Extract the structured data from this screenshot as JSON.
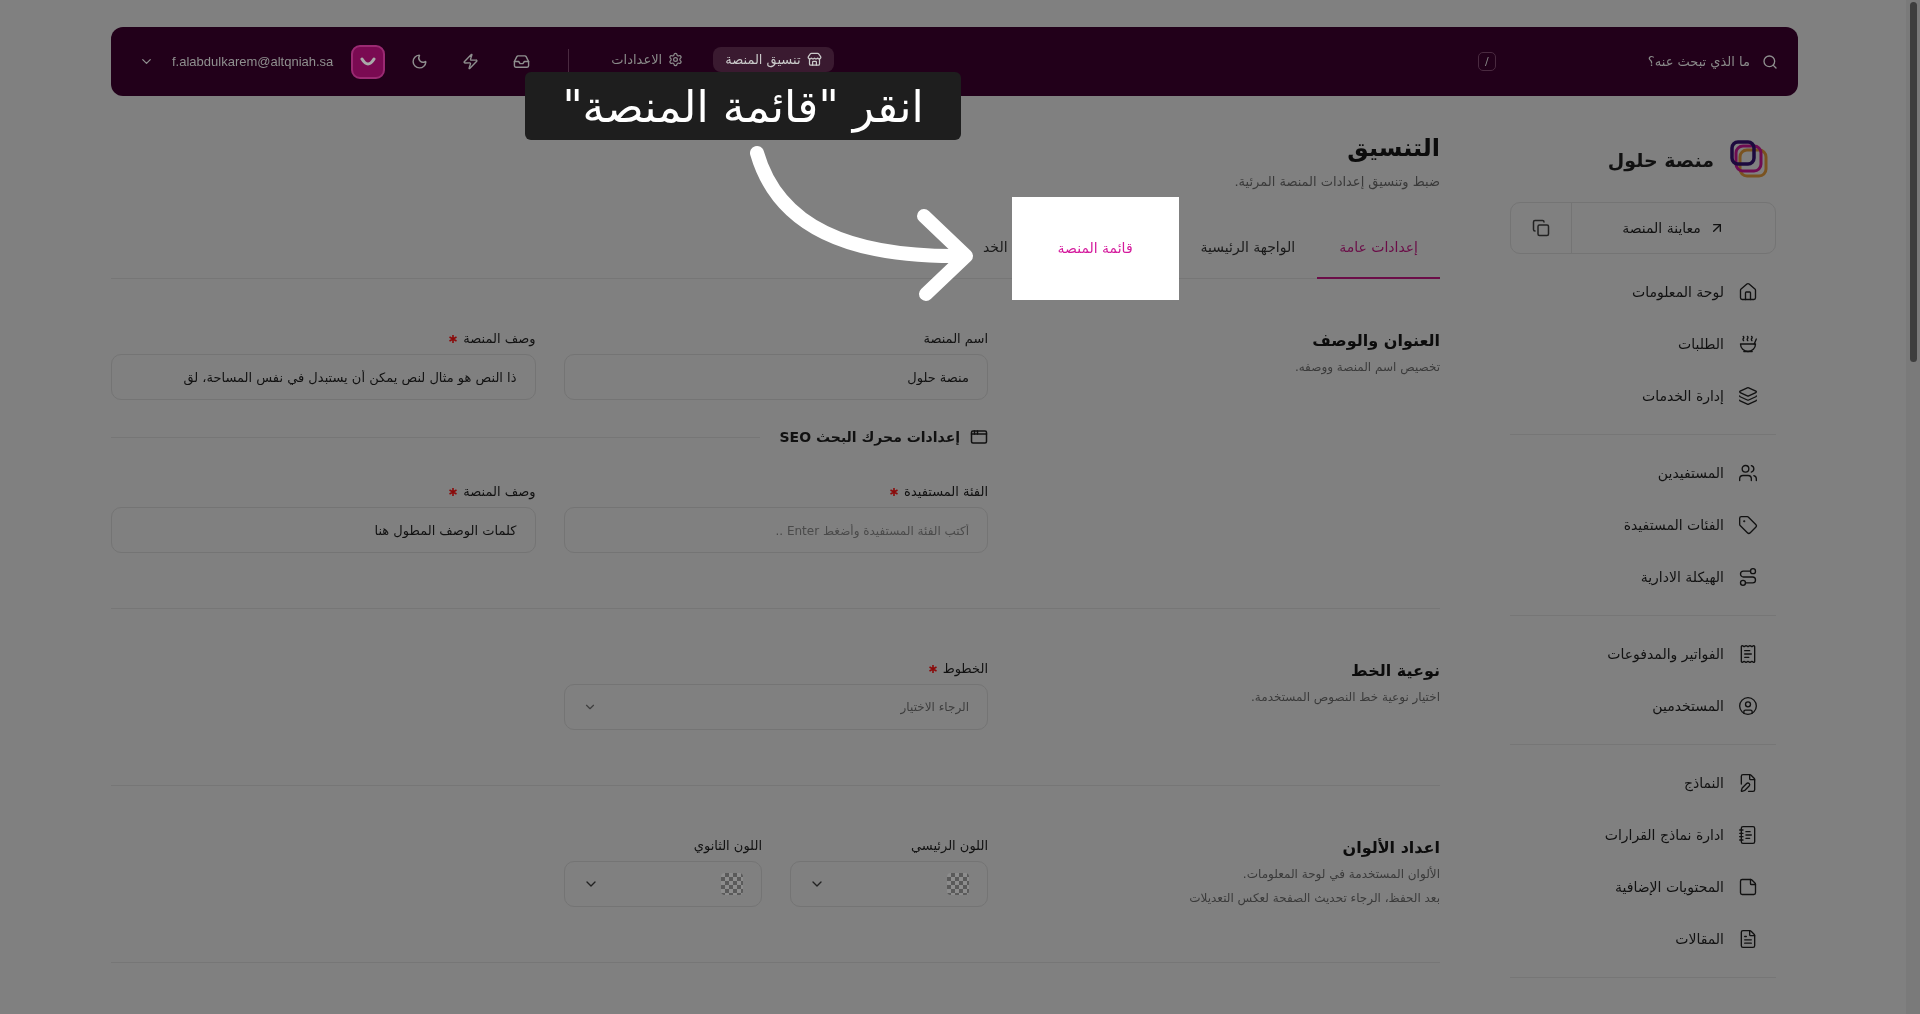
{
  "topbar": {
    "search_placeholder": "ما الذي تبحث عنه؟",
    "shortcut": "/",
    "nav": [
      {
        "label": "تنسيق المنصة",
        "selected": true
      },
      {
        "label": "الاعدادات",
        "selected": false
      }
    ],
    "user_email": "f.alabdulkarem@altqniah.sa"
  },
  "sidebar": {
    "brand": "منصة حلول",
    "preview_button": "معاينة المنصة",
    "groups": [
      [
        {
          "label": "لوحة المعلومات"
        },
        {
          "label": "الطلبات"
        },
        {
          "label": "إدارة الخدمات"
        }
      ],
      [
        {
          "label": "المستفيدين"
        },
        {
          "label": "الفئات المستفيدة"
        },
        {
          "label": "الهيكلة الادارية"
        }
      ],
      [
        {
          "label": "الفواتير والمدفوعات"
        },
        {
          "label": "المستخدمين"
        }
      ],
      [
        {
          "label": "النماذج"
        },
        {
          "label": "ادارة نماذج القرارات"
        },
        {
          "label": "المحتويات الإضافية"
        },
        {
          "label": "المقالات"
        }
      ]
    ]
  },
  "page": {
    "title": "التنسيق",
    "subtitle": "ضبط وتنسيق إعدادات المنصة المرئية."
  },
  "tabs": [
    {
      "label": "إعدادات عامة",
      "selected": true,
      "spotlight": false
    },
    {
      "label": "الواجهة الرئيسية",
      "selected": false,
      "spotlight": false
    },
    {
      "label": "قائمة المنصة",
      "selected": false,
      "spotlight": true
    },
    {
      "label": "الخد",
      "selected": false,
      "spotlight": false
    }
  ],
  "sections": [
    {
      "title": "العنوان والوصف",
      "descriptions": [
        "تخصيص اسم المنصة ووصفه."
      ],
      "rows": [
        {
          "kind": "fields",
          "fields": [
            {
              "kind": "text",
              "label": "اسم المنصة",
              "required": false,
              "value": "منصة حلول"
            },
            {
              "kind": "text",
              "label": "وصف المنصة",
              "required": true,
              "value": "ذا النص هو مثال لنص يمكن أن يستبدل في نفس المساحة، لق"
            }
          ]
        },
        {
          "kind": "subheading",
          "label": "إعدادات محرك البحث SEO"
        },
        {
          "kind": "fields",
          "fields": [
            {
              "kind": "text",
              "label": "الفئة المستفيدة",
              "required": true,
              "placeholder": "أكتب الفئة المستفيدة وأضغط Enter .."
            },
            {
              "kind": "text",
              "label": "وصف المنصة",
              "required": true,
              "value": "كلمات الوصف المطول هنا"
            }
          ]
        }
      ]
    },
    {
      "title": "نوعية الخط",
      "descriptions": [
        "اختيار نوعية خط النصوص المستخدمة."
      ],
      "rows": [
        {
          "kind": "fields",
          "fields": [
            {
              "kind": "select",
              "label": "الخطوط",
              "required": true,
              "placeholder": "الرجاء الاختيار"
            }
          ]
        }
      ]
    },
    {
      "title": "اعداد الألوان",
      "descriptions": [
        "الألوان المستخدمة في لوحة المعلومات.",
        "بعد الحفظ، الرجاء تحديث الصفحة لعكس التعديلات"
      ],
      "rows": [
        {
          "kind": "colors",
          "fields": [
            {
              "kind": "color",
              "label": "اللون الرئيسي",
              "required": false
            },
            {
              "kind": "color",
              "label": "اللون الثانوي",
              "required": false
            }
          ]
        }
      ]
    }
  ],
  "tutorial": {
    "text": "انقر \"قائمة المنصة\""
  }
}
